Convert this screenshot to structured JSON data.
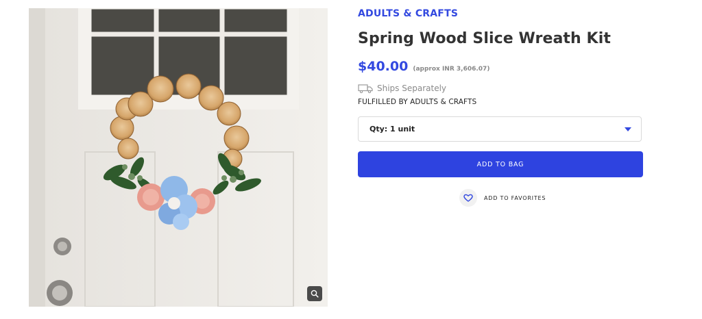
{
  "product": {
    "brand": "ADULTS & CRAFTS",
    "title": "Spring Wood Slice Wreath Kit",
    "price": "$40.00",
    "price_approx": "(approx INR 3,606.07)",
    "shipping": "Ships Separately",
    "fulfilled_by": "FULFILLED BY ADULTS & CRAFTS"
  },
  "quantity_select": {
    "selected": "Qty: 1 unit"
  },
  "actions": {
    "add_to_bag": "ADD TO BAG",
    "add_to_favorites": "ADD TO FAVORITES"
  },
  "icons": {
    "zoom": "magnifier-icon",
    "truck": "truck-icon",
    "caret": "caret-down-icon",
    "heart": "heart-icon"
  },
  "colors": {
    "accent": "#3349e0",
    "button": "#2e43e0",
    "muted_text": "#8a8a8a"
  }
}
